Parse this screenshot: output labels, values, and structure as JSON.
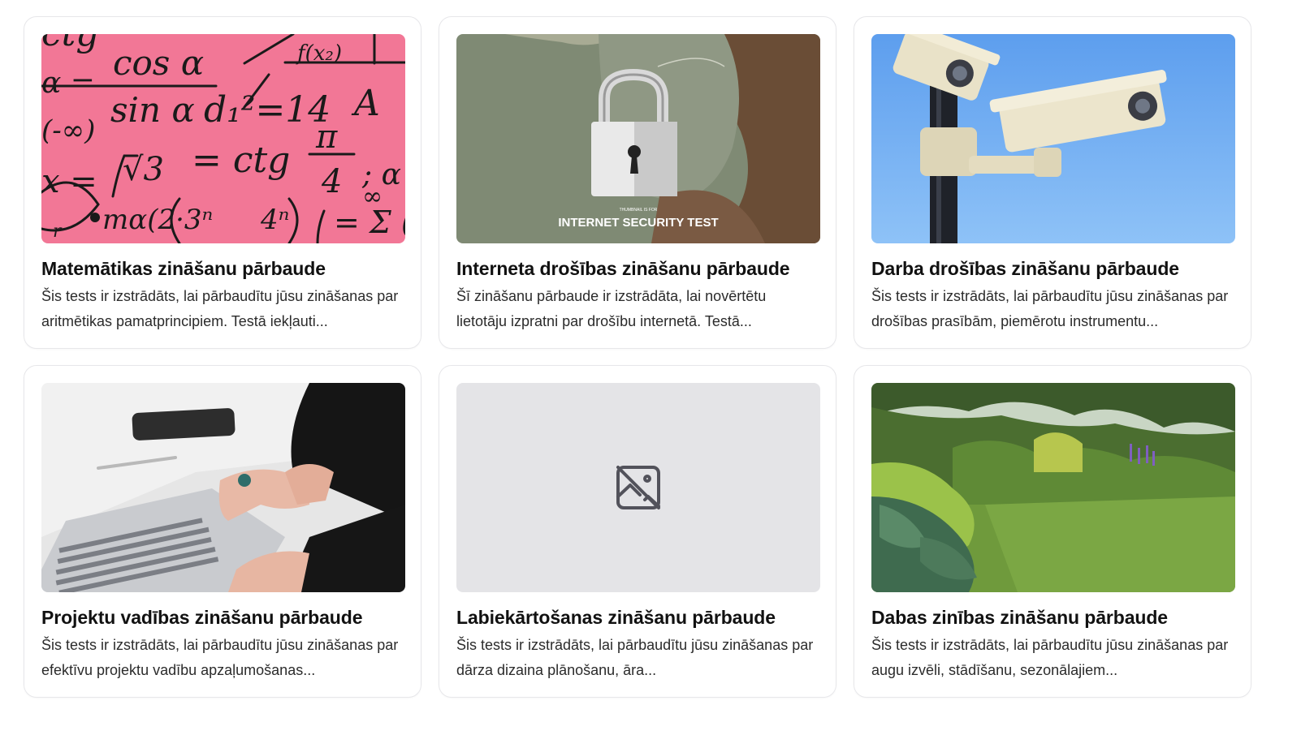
{
  "cards": [
    {
      "title": "Matemātikas zināšanu pārbaude",
      "description": "Šis tests ir izstrādāts, lai pārbaudītu jūsu zināšanas par aritmētikas pamatprincipiem. Testā iekļauti...",
      "image": "math-formulas-image"
    },
    {
      "title": "Interneta drošības zināšanu pārbaude",
      "description": "Šī zināšanu pārbaude ir izstrādāta, lai novērtētu lietotāju izpratni par drošību internetā. Testā...",
      "image": "padlock-image",
      "image_caption_small": "THUMBNAIL IS FOR",
      "image_caption": "INTERNET SECURITY TEST"
    },
    {
      "title": "Darba drošības zināšanu pārbaude",
      "description": "Šis tests ir izstrādāts, lai pārbaudītu jūsu zināšanas par drošības prasībām, piemērotu instrumentu...",
      "image": "security-cameras-image"
    },
    {
      "title": "Projektu vadības zināšanu pārbaude",
      "description": "Šis tests ir izstrādāts, lai pārbaudītu jūsu zināšanas par efektīvu projektu vadību apzaļumošanas...",
      "image": "laptop-typing-image"
    },
    {
      "title": "Labiekārtošanas zināšanu pārbaude",
      "description": "Šis tests ir izstrādāts, lai pārbaudītu jūsu zināšanas par dārza dizaina plānošanu, āra...",
      "image": "image-placeholder-icon"
    },
    {
      "title": "Dabas zinības zināšanu pārbaude",
      "description": "Šis tests ir izstrādāts, lai pārbaudītu jūsu zināšanas par augu izvēli, stādīšanu, sezonālajiem...",
      "image": "garden-image"
    }
  ],
  "colors": {
    "math_bg": "#f27796",
    "lock_bg": "#7f8a74",
    "sky": "#6fa9f0",
    "placeholder_bg": "#e4e4e7",
    "lawn": "#6b8f3a"
  }
}
